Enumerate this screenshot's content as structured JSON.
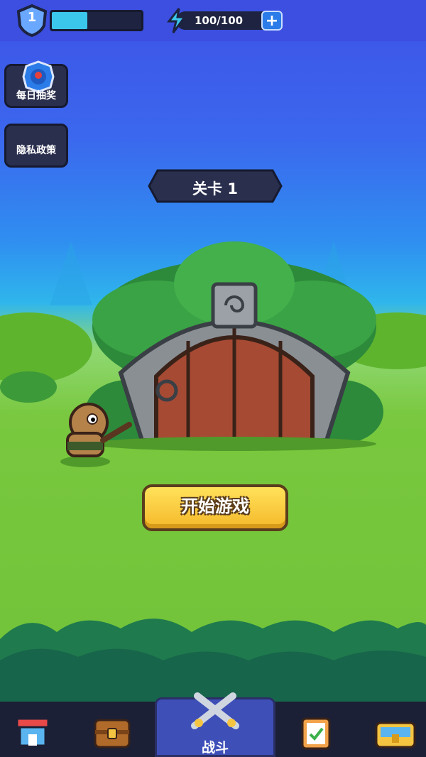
{
  "topbar": {
    "level": "1",
    "xp_progress": 0.4,
    "energy_text": "100/100",
    "energy_plus": "+"
  },
  "side_buttons": [
    {
      "label": "每日抽奖",
      "icon": "lucky-wheel-icon"
    },
    {
      "label": "隐私政策",
      "icon": ""
    }
  ],
  "stage": {
    "label": "关卡 1"
  },
  "start_button": {
    "label": "开始游戏"
  },
  "nav": {
    "items": [
      {
        "name": "shop",
        "icon": "shop-icon"
      },
      {
        "name": "inventory",
        "icon": "chest-icon"
      },
      {
        "name": "battle",
        "icon": "crossed-swords-icon",
        "label": "战斗",
        "active": true
      },
      {
        "name": "tasks",
        "icon": "clipboard-icon"
      },
      {
        "name": "treasure",
        "icon": "treasure-chest-icon"
      }
    ]
  },
  "colors": {
    "accent_yellow": "#f5b82a",
    "sky_top": "#3e52e6",
    "grass": "#6fc236",
    "nav_bg": "#1b2036",
    "nav_active": "#3e4fb8"
  }
}
